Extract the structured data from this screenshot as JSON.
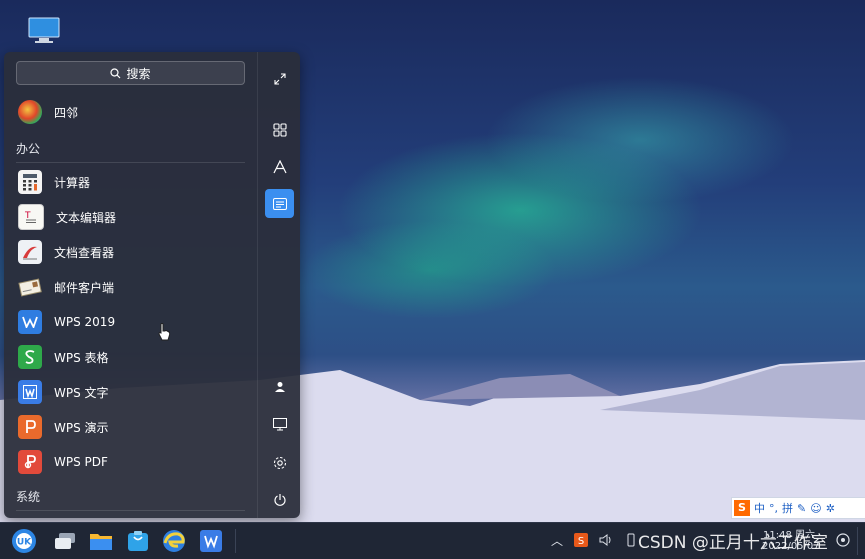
{
  "start_menu": {
    "search_label": "搜索",
    "pinned": [
      {
        "label": "四邻",
        "icon": "siling-app-icon"
      }
    ],
    "sections": [
      {
        "title": "办公",
        "apps": [
          {
            "label": "计算器",
            "icon": "calculator-icon"
          },
          {
            "label": "文本编辑器",
            "icon": "text-editor-icon"
          },
          {
            "label": "文档查看器",
            "icon": "document-viewer-icon"
          },
          {
            "label": "邮件客户端",
            "icon": "mail-client-icon"
          },
          {
            "label": "WPS 2019",
            "icon": "wps-icon"
          },
          {
            "label": "WPS 表格",
            "icon": "wps-spreadsheet-icon"
          },
          {
            "label": "WPS 文字",
            "icon": "wps-writer-icon"
          },
          {
            "label": "WPS 演示",
            "icon": "wps-presentation-icon"
          },
          {
            "label": "WPS PDF",
            "icon": "wps-pdf-icon"
          }
        ]
      },
      {
        "title": "系统",
        "apps": []
      }
    ],
    "side_buttons": [
      "expand-icon",
      "all-apps-icon",
      "letter-sort-icon",
      "category-view-icon",
      "user-icon",
      "computer-icon",
      "settings-icon",
      "power-icon"
    ]
  },
  "ime": {
    "logo": "S",
    "mode": "中",
    "punct": "°,",
    "pinyin": "拼"
  },
  "taskbar": {
    "apps": [
      "start-button-icon",
      "multitask-view-icon",
      "file-manager-icon",
      "software-store-icon",
      "browser-icon",
      "wps-taskbar-icon"
    ],
    "clock_time": "11:48 周六",
    "clock_date": "2022/05/07"
  },
  "watermark": "CSDN @正月十六工作室",
  "colors": {
    "accent": "#3b8ff0",
    "menu_bg": "#2a2e3a",
    "taskbar_bg": "#1f2635"
  }
}
